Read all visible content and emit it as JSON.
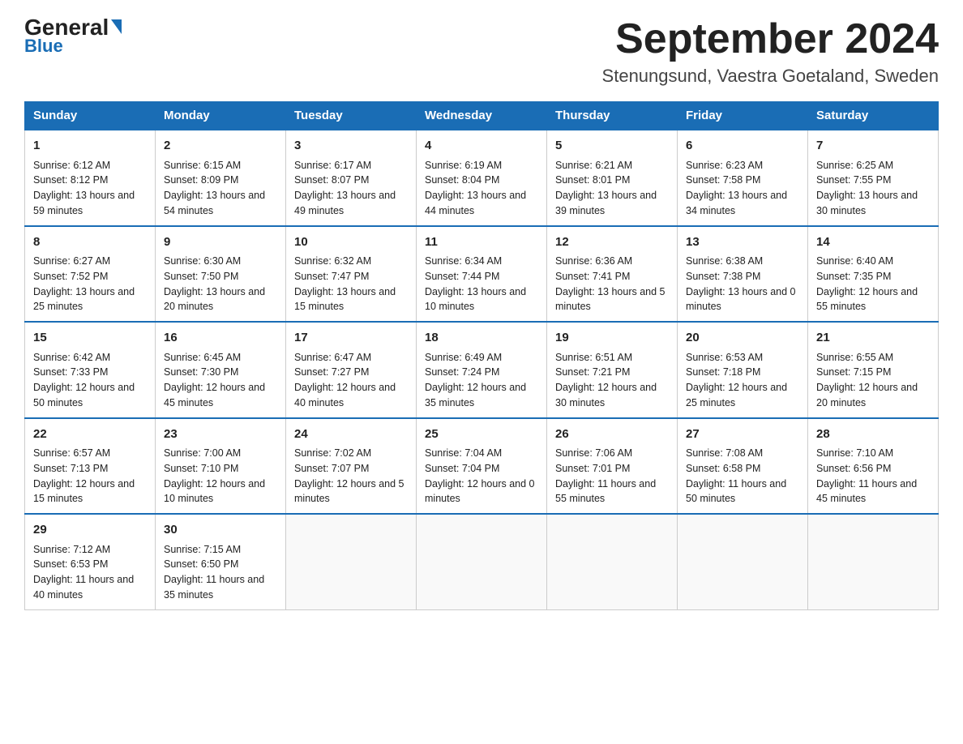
{
  "logo": {
    "general": "General",
    "blue": "Blue"
  },
  "title": {
    "month_year": "September 2024",
    "location": "Stenungsund, Vaestra Goetaland, Sweden"
  },
  "days_of_week": [
    "Sunday",
    "Monday",
    "Tuesday",
    "Wednesday",
    "Thursday",
    "Friday",
    "Saturday"
  ],
  "weeks": [
    [
      {
        "day": "1",
        "sunrise": "6:12 AM",
        "sunset": "8:12 PM",
        "daylight": "13 hours and 59 minutes."
      },
      {
        "day": "2",
        "sunrise": "6:15 AM",
        "sunset": "8:09 PM",
        "daylight": "13 hours and 54 minutes."
      },
      {
        "day": "3",
        "sunrise": "6:17 AM",
        "sunset": "8:07 PM",
        "daylight": "13 hours and 49 minutes."
      },
      {
        "day": "4",
        "sunrise": "6:19 AM",
        "sunset": "8:04 PM",
        "daylight": "13 hours and 44 minutes."
      },
      {
        "day": "5",
        "sunrise": "6:21 AM",
        "sunset": "8:01 PM",
        "daylight": "13 hours and 39 minutes."
      },
      {
        "day": "6",
        "sunrise": "6:23 AM",
        "sunset": "7:58 PM",
        "daylight": "13 hours and 34 minutes."
      },
      {
        "day": "7",
        "sunrise": "6:25 AM",
        "sunset": "7:55 PM",
        "daylight": "13 hours and 30 minutes."
      }
    ],
    [
      {
        "day": "8",
        "sunrise": "6:27 AM",
        "sunset": "7:52 PM",
        "daylight": "13 hours and 25 minutes."
      },
      {
        "day": "9",
        "sunrise": "6:30 AM",
        "sunset": "7:50 PM",
        "daylight": "13 hours and 20 minutes."
      },
      {
        "day": "10",
        "sunrise": "6:32 AM",
        "sunset": "7:47 PM",
        "daylight": "13 hours and 15 minutes."
      },
      {
        "day": "11",
        "sunrise": "6:34 AM",
        "sunset": "7:44 PM",
        "daylight": "13 hours and 10 minutes."
      },
      {
        "day": "12",
        "sunrise": "6:36 AM",
        "sunset": "7:41 PM",
        "daylight": "13 hours and 5 minutes."
      },
      {
        "day": "13",
        "sunrise": "6:38 AM",
        "sunset": "7:38 PM",
        "daylight": "13 hours and 0 minutes."
      },
      {
        "day": "14",
        "sunrise": "6:40 AM",
        "sunset": "7:35 PM",
        "daylight": "12 hours and 55 minutes."
      }
    ],
    [
      {
        "day": "15",
        "sunrise": "6:42 AM",
        "sunset": "7:33 PM",
        "daylight": "12 hours and 50 minutes."
      },
      {
        "day": "16",
        "sunrise": "6:45 AM",
        "sunset": "7:30 PM",
        "daylight": "12 hours and 45 minutes."
      },
      {
        "day": "17",
        "sunrise": "6:47 AM",
        "sunset": "7:27 PM",
        "daylight": "12 hours and 40 minutes."
      },
      {
        "day": "18",
        "sunrise": "6:49 AM",
        "sunset": "7:24 PM",
        "daylight": "12 hours and 35 minutes."
      },
      {
        "day": "19",
        "sunrise": "6:51 AM",
        "sunset": "7:21 PM",
        "daylight": "12 hours and 30 minutes."
      },
      {
        "day": "20",
        "sunrise": "6:53 AM",
        "sunset": "7:18 PM",
        "daylight": "12 hours and 25 minutes."
      },
      {
        "day": "21",
        "sunrise": "6:55 AM",
        "sunset": "7:15 PM",
        "daylight": "12 hours and 20 minutes."
      }
    ],
    [
      {
        "day": "22",
        "sunrise": "6:57 AM",
        "sunset": "7:13 PM",
        "daylight": "12 hours and 15 minutes."
      },
      {
        "day": "23",
        "sunrise": "7:00 AM",
        "sunset": "7:10 PM",
        "daylight": "12 hours and 10 minutes."
      },
      {
        "day": "24",
        "sunrise": "7:02 AM",
        "sunset": "7:07 PM",
        "daylight": "12 hours and 5 minutes."
      },
      {
        "day": "25",
        "sunrise": "7:04 AM",
        "sunset": "7:04 PM",
        "daylight": "12 hours and 0 minutes."
      },
      {
        "day": "26",
        "sunrise": "7:06 AM",
        "sunset": "7:01 PM",
        "daylight": "11 hours and 55 minutes."
      },
      {
        "day": "27",
        "sunrise": "7:08 AM",
        "sunset": "6:58 PM",
        "daylight": "11 hours and 50 minutes."
      },
      {
        "day": "28",
        "sunrise": "7:10 AM",
        "sunset": "6:56 PM",
        "daylight": "11 hours and 45 minutes."
      }
    ],
    [
      {
        "day": "29",
        "sunrise": "7:12 AM",
        "sunset": "6:53 PM",
        "daylight": "11 hours and 40 minutes."
      },
      {
        "day": "30",
        "sunrise": "7:15 AM",
        "sunset": "6:50 PM",
        "daylight": "11 hours and 35 minutes."
      },
      null,
      null,
      null,
      null,
      null
    ]
  ],
  "labels": {
    "sunrise": "Sunrise:",
    "sunset": "Sunset:",
    "daylight": "Daylight:"
  }
}
